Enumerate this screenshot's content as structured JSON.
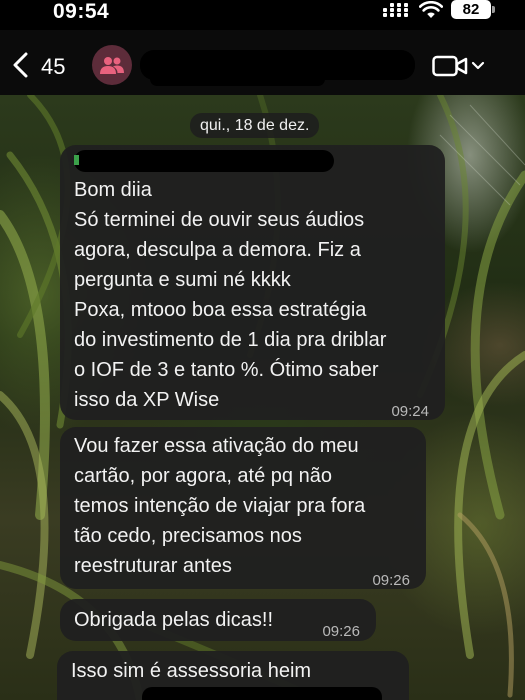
{
  "status_bar": {
    "time": "09:54",
    "battery": "82"
  },
  "header": {
    "back_count": "45",
    "avatar_icon": "group-icon",
    "video_icon": "video-camera-icon",
    "accent_color": "#e8627e"
  },
  "date_separator": "qui., 18 de dez.",
  "messages": [
    {
      "text": "Bom diia\nSó terminei de ouvir seus áudios\nagora, desculpa a demora. Fiz a\npergunta e sumi né kkkk\nPoxa, mtooo boa essa estratégia\ndo investimento de 1 dia pra driblar\no IOF de 3 e tanto %. Ótimo saber\nisso da XP Wise",
      "time": "09:24"
    },
    {
      "text": "Vou fazer essa ativação do meu\ncartão, por agora, até pq não\ntemos intenção de viajar pra fora\ntão cedo, precisamos nos\nreestruturar antes",
      "time": "09:26"
    },
    {
      "text": "Obrigada pelas dicas!!",
      "time": "09:26"
    },
    {
      "text": "Isso sim é assessoria heim",
      "time": ""
    }
  ]
}
